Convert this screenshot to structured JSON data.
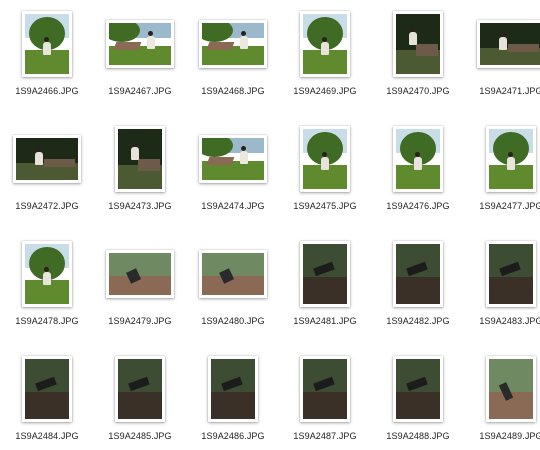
{
  "files": [
    {
      "name": "1S9A2466.JPG",
      "orientation": "portrait",
      "scene": "bright-tree"
    },
    {
      "name": "1S9A2467.JPG",
      "orientation": "landscape",
      "scene": "bench-person"
    },
    {
      "name": "1S9A2468.JPG",
      "orientation": "landscape",
      "scene": "bench-person"
    },
    {
      "name": "1S9A2469.JPG",
      "orientation": "portrait",
      "scene": "bright-tree"
    },
    {
      "name": "1S9A2470.JPG",
      "orientation": "portrait",
      "scene": "dark-bench"
    },
    {
      "name": "1S9A2471.JPG",
      "orientation": "landscape",
      "scene": "dark-bench"
    },
    {
      "name": "1S9A2472.JPG",
      "orientation": "landscape",
      "scene": "dark-bench"
    },
    {
      "name": "1S9A2473.JPG",
      "orientation": "portrait",
      "scene": "dark-bench"
    },
    {
      "name": "1S9A2474.JPG",
      "orientation": "landscape",
      "scene": "bench-person"
    },
    {
      "name": "1S9A2475.JPG",
      "orientation": "portrait",
      "scene": "bright-tree"
    },
    {
      "name": "1S9A2476.JPG",
      "orientation": "portrait",
      "scene": "bright-tree"
    },
    {
      "name": "1S9A2477.JPG",
      "orientation": "portrait",
      "scene": "bright-tree"
    },
    {
      "name": "1S9A2478.JPG",
      "orientation": "portrait",
      "scene": "bright-tree"
    },
    {
      "name": "1S9A2479.JPG",
      "orientation": "landscape",
      "scene": "bench-closeup"
    },
    {
      "name": "1S9A2480.JPG",
      "orientation": "landscape",
      "scene": "bench-closeup"
    },
    {
      "name": "1S9A2481.JPG",
      "orientation": "portrait",
      "scene": "dark-closeup"
    },
    {
      "name": "1S9A2482.JPG",
      "orientation": "portrait",
      "scene": "dark-closeup"
    },
    {
      "name": "1S9A2483.JPG",
      "orientation": "portrait",
      "scene": "dark-closeup"
    },
    {
      "name": "1S9A2484.JPG",
      "orientation": "portrait",
      "scene": "dark-closeup"
    },
    {
      "name": "1S9A2485.JPG",
      "orientation": "portrait",
      "scene": "dark-closeup"
    },
    {
      "name": "1S9A2486.JPG",
      "orientation": "portrait",
      "scene": "dark-closeup"
    },
    {
      "name": "1S9A2487.JPG",
      "orientation": "portrait",
      "scene": "dark-closeup"
    },
    {
      "name": "1S9A2488.JPG",
      "orientation": "portrait",
      "scene": "dark-closeup"
    },
    {
      "name": "1S9A2489.JPG",
      "orientation": "portrait",
      "scene": "bench-closeup"
    }
  ],
  "colors": {
    "background": "#ffffff",
    "label_text": "#1f1f1f",
    "grass": "#5f8a2e",
    "sky": "#c9dde8",
    "foliage": "#3f6b24",
    "dark_foliage": "#1d2a18",
    "wood": "#8a6a55"
  }
}
